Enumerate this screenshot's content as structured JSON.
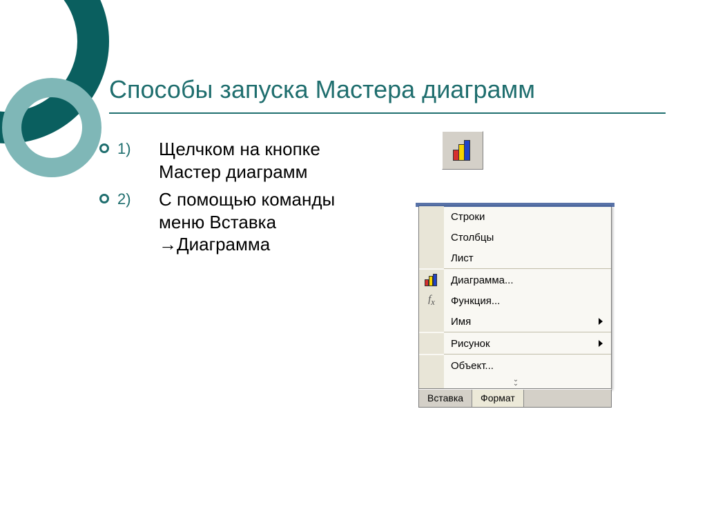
{
  "title": "Способы запуска Мастера диаграмм",
  "list": {
    "item1": "Щелчком на кнопке Мастер диаграмм",
    "item2": "С помощью команды меню Вставка →Диаграмма"
  },
  "menu": {
    "rows": "Строки",
    "cols": "Столбцы",
    "sheet": "Лист",
    "chart": "Диаграмма...",
    "func": "Функция...",
    "name": "Имя",
    "picture": "Рисунок",
    "object": "Объект..."
  },
  "tabs": {
    "insert": "Вставка",
    "format": "Формат"
  }
}
